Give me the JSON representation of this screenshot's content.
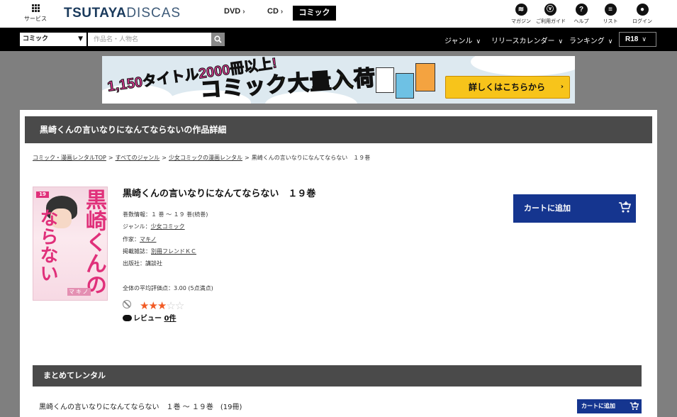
{
  "header": {
    "service_label": "サービス",
    "logo_bold": "TSUTAYA",
    "logo_rest": "DISCAS",
    "nav": {
      "dvd": "DVD",
      "cd": "CD",
      "comic": "コミック"
    },
    "icons": [
      {
        "label": "マガジン",
        "glyph": "≋",
        "icon": "magazine-icon"
      },
      {
        "label": "ご利用ガイド",
        "glyph": "↻",
        "icon": "guide-icon"
      },
      {
        "label": "ヘルプ",
        "glyph": "?",
        "icon": "help-icon"
      },
      {
        "label": "リスト",
        "glyph": "≡",
        "icon": "list-icon"
      },
      {
        "label": "ログイン",
        "glyph": "●",
        "icon": "login-icon"
      }
    ]
  },
  "search": {
    "category": "コミック",
    "placeholder": "作品名・人物名",
    "menu": {
      "genre": "ジャンル",
      "release": "リリースカレンダー",
      "ranking": "ランキング",
      "r18": "R18"
    }
  },
  "banner": {
    "lead": "1,150タイトル2000冊以上!",
    "headline": "コミック大量入荷!",
    "cta": "詳しくはこちらから"
  },
  "page": {
    "title": "黒崎くんの言いなりになんてならないの作品詳細",
    "breadcrumb": [
      "コミック・漫画レンタルTOP",
      "すべてのジャンル",
      "少女コミックの漫画レンタル",
      "黒崎くんの言いなりになんてならない　１９巻"
    ]
  },
  "work": {
    "title": "黒崎くんの言いなりになんてならない　１９巻",
    "volumes_label": "巻数情報：",
    "volumes_value": "１ 巻 ～ １９ 巻(続巻)",
    "genre_label": "ジャンル：",
    "genre_value": "少女コミック",
    "author_label": "作家：",
    "author_value": "マキノ",
    "magazine_label": "掲載雑誌：",
    "magazine_value": "別冊フレンドＫＣ",
    "publisher_label": "出版社：",
    "publisher_value": "講談社",
    "rating_label": "全体の平均評価点：",
    "rating_value": "3.00 (5点満点)",
    "rating_stars": 3,
    "rating_max": 5,
    "review_label": "レビュー",
    "review_count": "0件",
    "cart_label": "カートに追加",
    "cover": {
      "title_line1": "黒崎くんの",
      "title_line2": "言いなり",
      "title_line3": "になんて",
      "title_line4": "ならない",
      "volume": "19",
      "author": "マキノ"
    }
  },
  "bundle": {
    "title": "まとめてレンタル",
    "item_text": "黒崎くんの言いなりになんてならない　１巻 ～ １９巻　(19冊)",
    "cart_label": "カートに追加"
  },
  "colors": {
    "accent_blue": "#15358f",
    "star": "#f15a24",
    "title_bar": "#4a4a4a"
  }
}
